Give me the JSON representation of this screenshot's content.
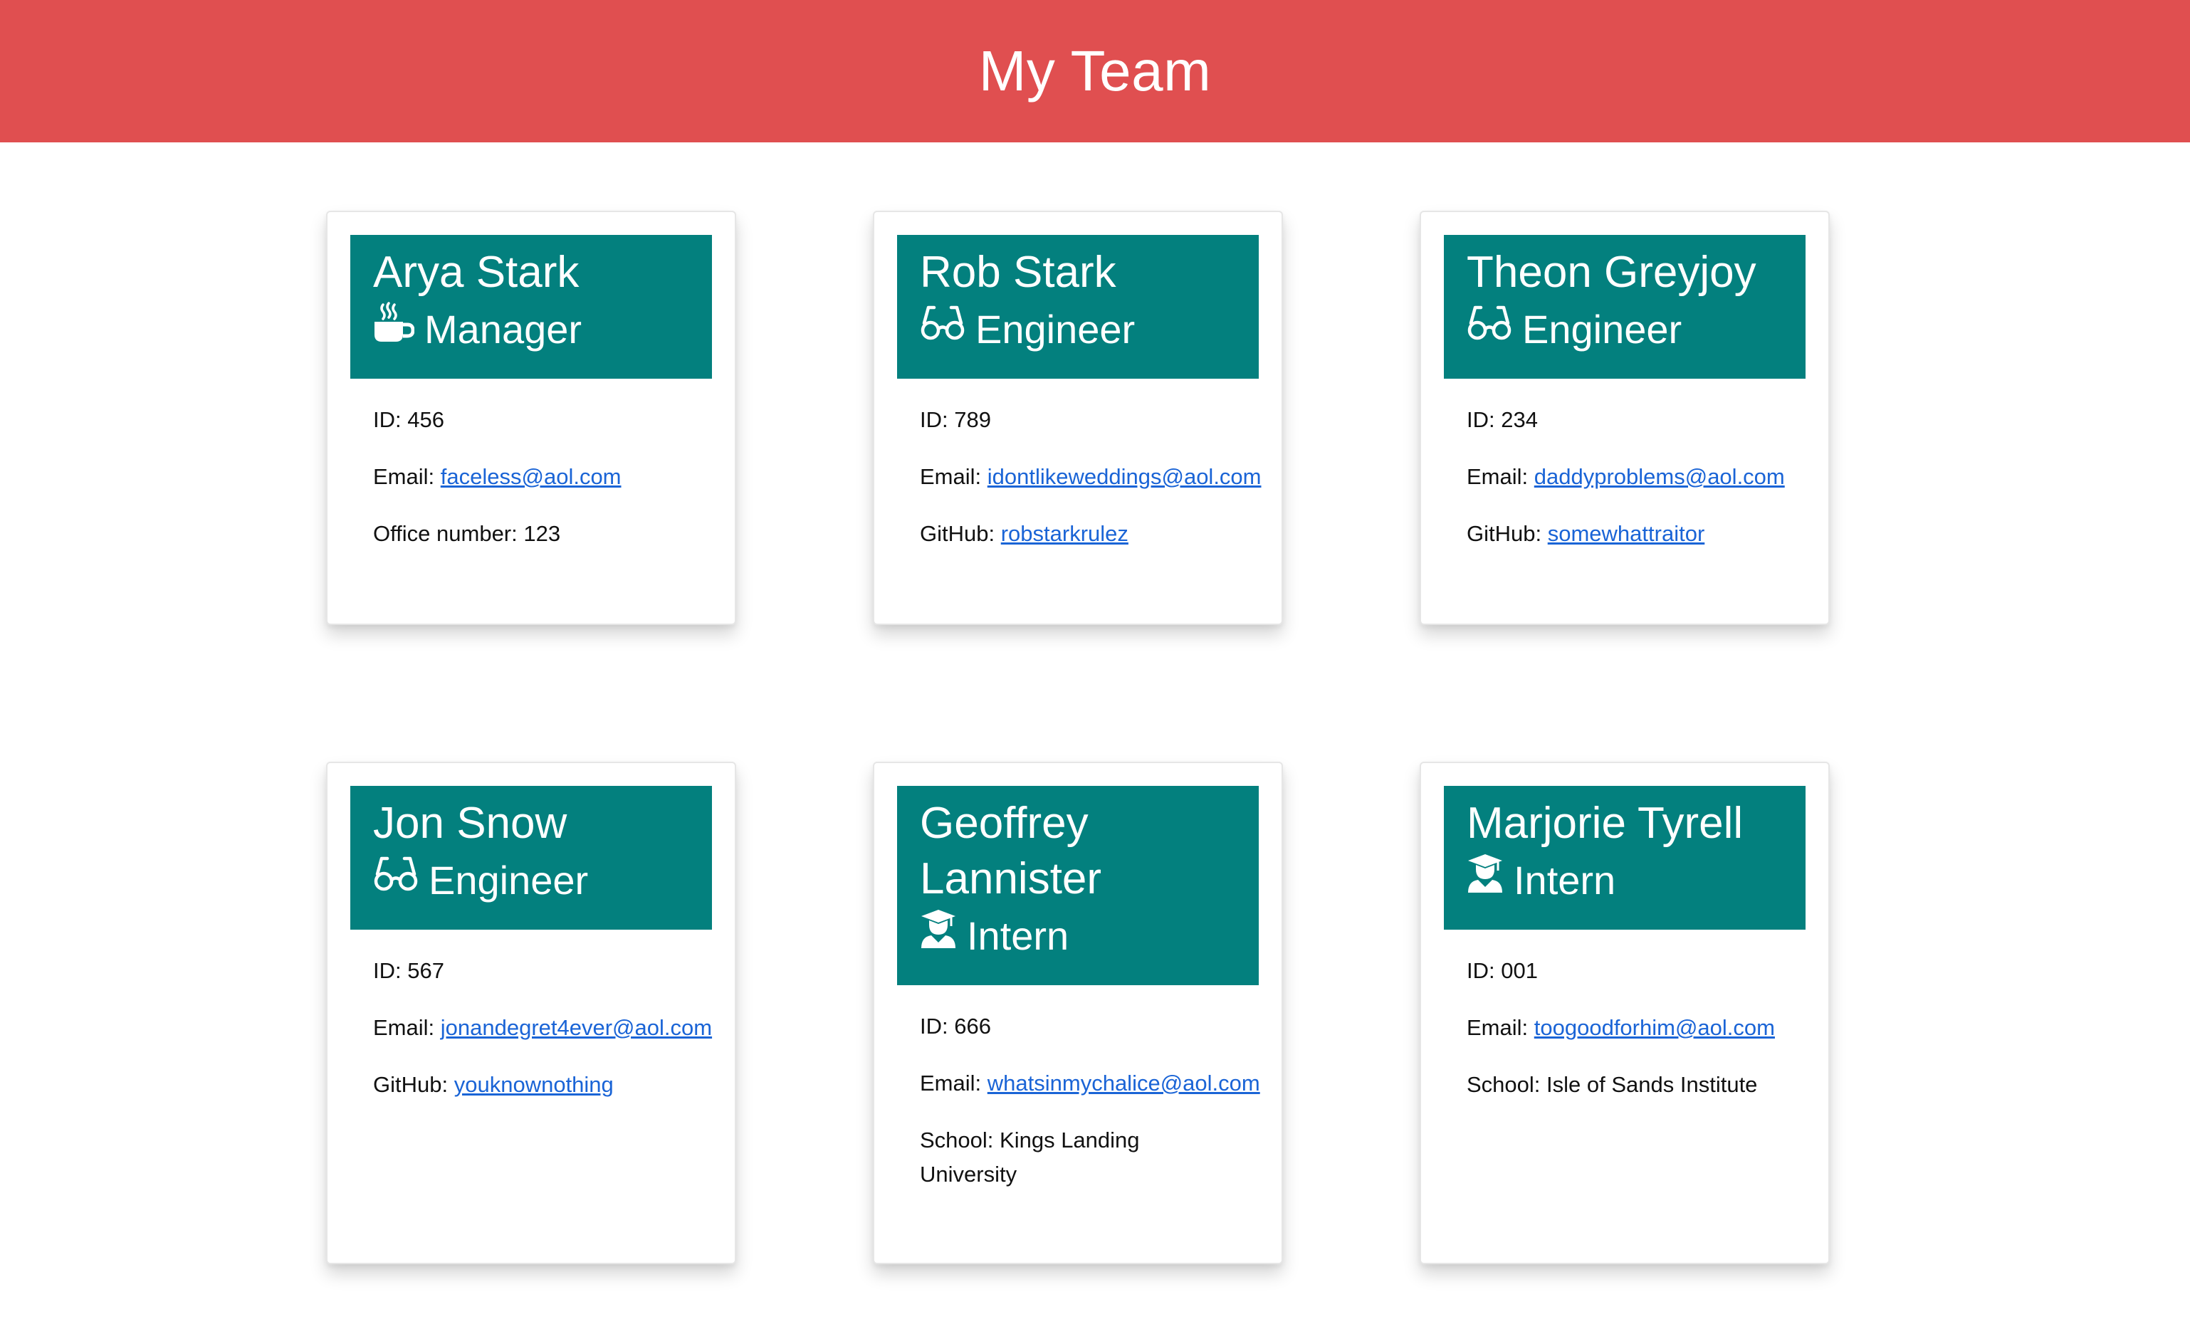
{
  "page": {
    "title": "My Team"
  },
  "colors": {
    "header_bg": "#e04f50",
    "card_head_bg": "#03807e",
    "link": "#1a64d6"
  },
  "labels": {
    "id": "ID:",
    "email": "Email:",
    "office": "Office number:",
    "github": "GitHub:",
    "school": "School:"
  },
  "members": [
    {
      "name": "Arya Stark",
      "role": "Manager",
      "icon": "coffee-icon",
      "id": "456",
      "email": "faceless@aol.com",
      "office": "123"
    },
    {
      "name": "Rob Stark",
      "role": "Engineer",
      "icon": "glasses-icon",
      "id": "789",
      "email": "idontlikeweddings@aol.com",
      "github": "robstarkrulez"
    },
    {
      "name": "Theon Greyjoy",
      "role": "Engineer",
      "icon": "glasses-icon",
      "id": "234",
      "email": "daddyproblems@aol.com",
      "github": "somewhattraitor"
    },
    {
      "name": "Jon Snow",
      "role": "Engineer",
      "icon": "glasses-icon",
      "id": "567",
      "email": "jonandegret4ever@aol.com",
      "github": "youknownothing"
    },
    {
      "name": "Geoffrey Lannister",
      "role": "Intern",
      "icon": "graduate-icon",
      "id": "666",
      "email": "whatsinmychalice@aol.com",
      "school": "Kings Landing University"
    },
    {
      "name": "Marjorie Tyrell",
      "role": "Intern",
      "icon": "graduate-icon",
      "id": "001",
      "email": "toogoodforhim@aol.com",
      "school": "Isle of Sands Institute"
    }
  ]
}
